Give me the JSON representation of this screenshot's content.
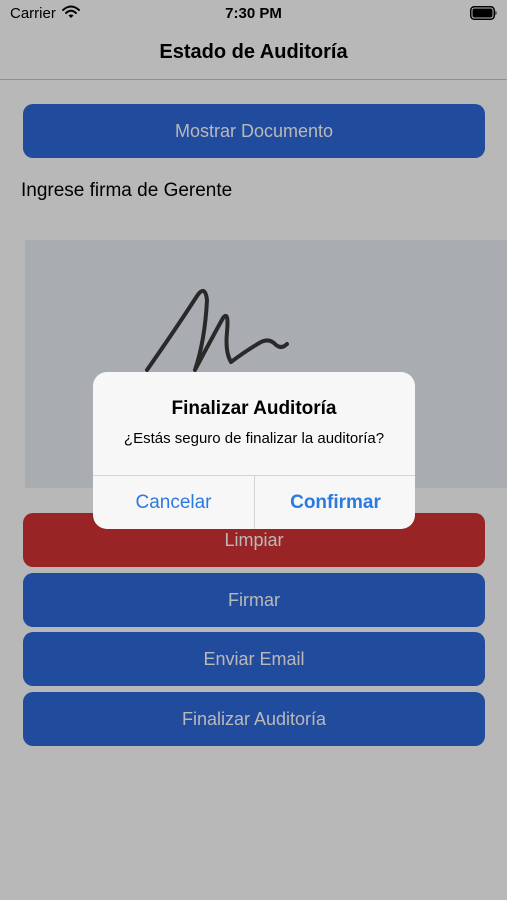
{
  "status_bar": {
    "carrier": "Carrier",
    "time": "7:30 PM"
  },
  "nav": {
    "title": "Estado de Auditoría"
  },
  "main": {
    "show_document_label": "Mostrar Documento",
    "signature_prompt": "Ingrese firma de Gerente",
    "clear_label": "Limpiar",
    "sign_label": "Firmar",
    "send_email_label": "Enviar Email",
    "finish_label": "Finalizar Auditoría"
  },
  "alert": {
    "title": "Finalizar Auditoría",
    "message": "¿Estás seguro de finalizar la auditoría?",
    "cancel_label": "Cancelar",
    "confirm_label": "Confirmar"
  },
  "colors": {
    "primary_button": "#2f68d8",
    "destructive_button": "#d43335",
    "alert_action": "#2a7ae2",
    "signature_pad": "#eaf0f5"
  },
  "icons": [
    "wifi-icon",
    "battery-icon"
  ]
}
